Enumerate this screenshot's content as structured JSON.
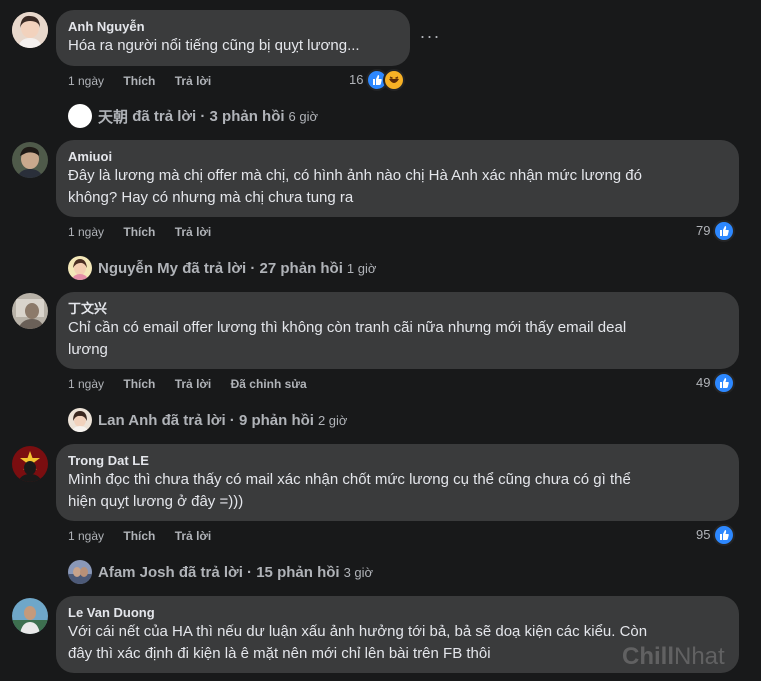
{
  "comments": [
    {
      "author": "Anh Nguyễn",
      "text": "Hóa ra người nổi tiếng cũng bị quỵt lương...",
      "time": "1 ngày",
      "like": "Thích",
      "reply": "Trả lời",
      "reaction_count": "16",
      "replies": {
        "name": "天朝",
        "verb": "đã trả lời",
        "count": "3 phản hồi",
        "time": "6 giờ"
      }
    },
    {
      "author": "Amiuoi",
      "text": "Đây là lương mà chị offer mà chị, có hình ảnh nào chị Hà Anh xác nhận mức lương đó\nkhông? Hay có nhưng mà chị chưa tung ra",
      "time": "1 ngày",
      "like": "Thích",
      "reply": "Trả lời",
      "reaction_count": "79",
      "replies": {
        "name": "Nguyễn My",
        "verb": "đã trả lời",
        "count": "27 phản hồi",
        "time": "1 giờ"
      }
    },
    {
      "author": "丁文兴",
      "text": "Chỉ cần có email offer lương thì không còn tranh cãi nữa nhưng mới thấy email deal\nlương",
      "time": "1 ngày",
      "like": "Thích",
      "reply": "Trả lời",
      "edited": "Đã chỉnh sửa",
      "reaction_count": "49",
      "replies": {
        "name": "Lan Anh",
        "verb": "đã trả lời",
        "count": "9 phản hồi",
        "time": "2 giờ"
      }
    },
    {
      "author": "Trong Dat LE",
      "text": "Mình đọc thì chưa thấy có mail xác nhận chốt mức lương cụ thể cũng chưa có gì thể\nhiện quỵt lương ở đây =)))",
      "time": "1 ngày",
      "like": "Thích",
      "reply": "Trả lời",
      "reaction_count": "95",
      "replies": {
        "name": "Afam Josh",
        "verb": "đã trả lời",
        "count": "15 phản hồi",
        "time": "3 giờ"
      }
    },
    {
      "author": "Le Van Duong",
      "text": "Với cái nết của HA thì nếu dư luận xấu ảnh hưởng tới bả, bả sẽ doạ kiện các kiểu. Còn\nđây thì xác định đi kiện là ê mặt nên mới chỉ lên bài trên FB thôi"
    }
  ],
  "more_options": "···",
  "watermark": {
    "part1": "Chill",
    "part2": "Nhat"
  },
  "icons": {
    "like": "like-icon",
    "haha": "haha-icon",
    "more": "more-options-icon"
  },
  "colors": {
    "background": "#18191a",
    "bubble": "#3a3b3c",
    "like_blue": "#2d88ff",
    "secondary_text": "#b0b3b8"
  }
}
